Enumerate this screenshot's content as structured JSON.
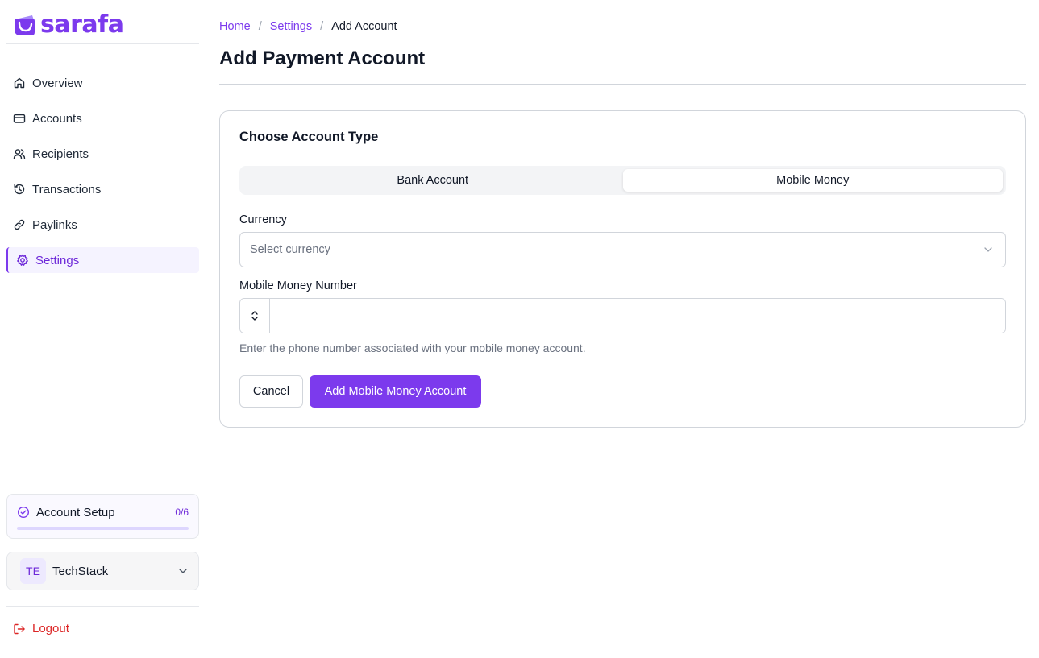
{
  "brand": {
    "name": "sarafa",
    "logo_icon": "wallet-logo-icon",
    "accent": "#7c3aed"
  },
  "sidebar": {
    "items": [
      {
        "label": "Overview",
        "icon": "home-icon",
        "active": false
      },
      {
        "label": "Accounts",
        "icon": "credit-card-icon",
        "active": false
      },
      {
        "label": "Recipients",
        "icon": "users-icon",
        "active": false
      },
      {
        "label": "Transactions",
        "icon": "history-icon",
        "active": false
      },
      {
        "label": "Paylinks",
        "icon": "link-icon",
        "active": false
      },
      {
        "label": "Settings",
        "icon": "gear-icon",
        "active": true
      }
    ],
    "setup": {
      "title": "Account Setup",
      "count": "0/6",
      "progress": 0
    },
    "org": {
      "initials": "TE",
      "name": "TechStack"
    },
    "logout_label": "Logout"
  },
  "breadcrumb": {
    "items": [
      "Home",
      "Settings"
    ],
    "separator": "/",
    "current": "Add Account"
  },
  "page": {
    "title": "Add Payment Account"
  },
  "form": {
    "section_title": "Choose Account Type",
    "tabs": [
      {
        "label": "Bank Account",
        "active": false
      },
      {
        "label": "Mobile Money",
        "active": true
      }
    ],
    "currency": {
      "label": "Currency",
      "placeholder": "Select currency"
    },
    "mobile_number": {
      "label": "Mobile Money Number",
      "value": "",
      "helper": "Enter the phone number associated with your mobile money account."
    },
    "cancel_label": "Cancel",
    "submit_label": "Add Mobile Money Account"
  },
  "colors": {
    "accent": "#7c3aed",
    "danger": "#dc2626",
    "muted": "#6b7280"
  }
}
